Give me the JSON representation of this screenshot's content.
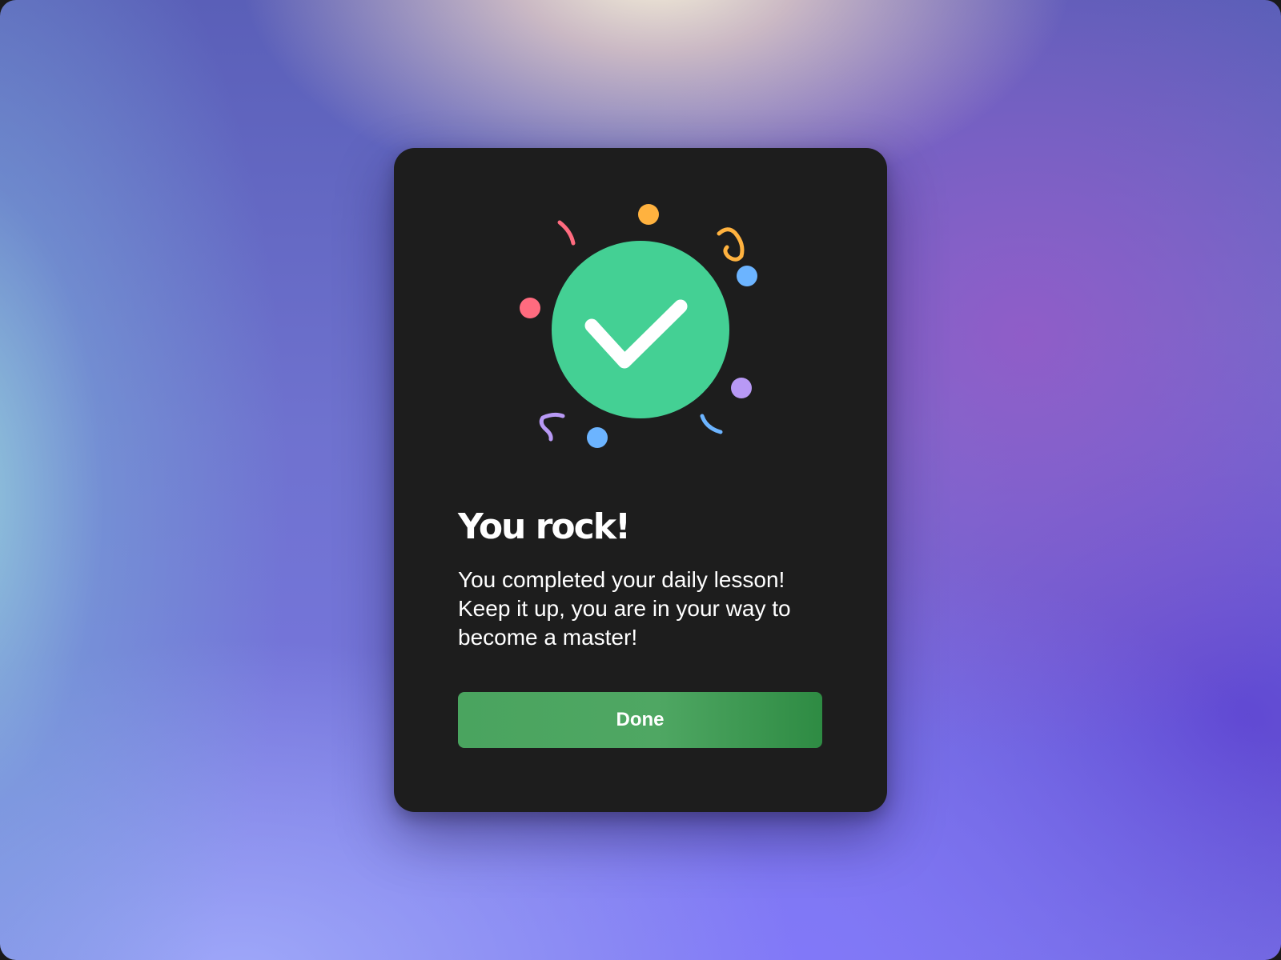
{
  "dialog": {
    "title": "You rock!",
    "message": "You completed your daily lesson! Keep it up, you are in your way to become a master!",
    "done_label": "Done"
  },
  "icons": {
    "main": "checkmark-circle-icon",
    "decoration": "confetti"
  },
  "colors": {
    "success_circle": "#44d094",
    "button_start": "#4aa45f",
    "button_end": "#2e8b43",
    "card_background": "#1d1d1d",
    "confetti_red": "#ff6b7f",
    "confetti_orange": "#ffb23f",
    "confetti_blue": "#6cb4ff",
    "confetti_purple": "#b899f5"
  }
}
